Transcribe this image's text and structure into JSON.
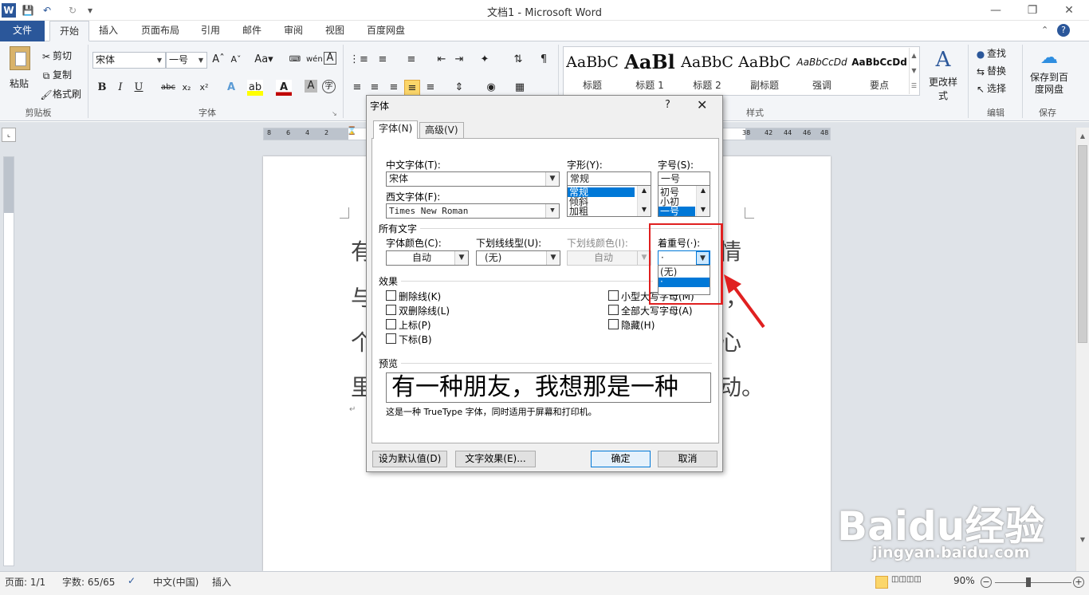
{
  "window": {
    "title": "文档1 - Microsoft Word"
  },
  "ribbon_tabs": [
    "文件",
    "开始",
    "插入",
    "页面布局",
    "引用",
    "邮件",
    "审阅",
    "视图",
    "百度网盘"
  ],
  "clipboard": {
    "paste": "粘贴",
    "cut": "剪切",
    "copy": "复制",
    "format_painter": "格式刷",
    "group": "剪贴板"
  },
  "font_group": {
    "font": "宋体",
    "size": "一号",
    "group": "字体",
    "bold": "B",
    "italic": "I",
    "underline": "U",
    "strike": "abc",
    "sub": "x₂",
    "sup": "x²"
  },
  "paragraph_group": {
    "group": "段落"
  },
  "styles": {
    "items": [
      {
        "preview": "AaBbC",
        "name": "标题"
      },
      {
        "preview": "AaBl",
        "name": "标题 1"
      },
      {
        "preview": "AaBbC",
        "name": "标题 2"
      },
      {
        "preview": "AaBbC",
        "name": "副标题"
      },
      {
        "preview": "AaBbCcDd",
        "name": "强调"
      },
      {
        "preview": "AaBbCcDd",
        "name": "要点"
      }
    ],
    "change_styles": "更改样式",
    "group": "样式"
  },
  "editing": {
    "find": "查找",
    "replace": "替换",
    "select": "选择",
    "group": "编辑"
  },
  "save_group": {
    "save_baidu": "保存到百度网盘",
    "group": "保存"
  },
  "ruler_ticks": [
    "8",
    "6",
    "4",
    "2",
    "2",
    "4",
    "6",
    "8",
    "38",
    "42",
    "44",
    "46",
    "48"
  ],
  "document": {
    "left_chars": [
      "有",
      "与",
      "个",
      "里"
    ],
    "right_chars": [
      "情",
      "，",
      "心",
      "动。"
    ],
    "para_mark": "↵"
  },
  "dialog": {
    "title": "字体",
    "help": "?",
    "tabs": [
      "字体(N)",
      "高级(V)"
    ],
    "cn_font_label": "中文字体(T):",
    "cn_font_value": "宋体",
    "west_font_label": "西文字体(F):",
    "west_font_value": "Times New Roman",
    "style_label": "字形(Y):",
    "style_value": "常规",
    "style_options": [
      "常规",
      "倾斜",
      "加粗"
    ],
    "size_label": "字号(S):",
    "size_value": "一号",
    "size_options": [
      "初号",
      "小初",
      "一号"
    ],
    "all_text_section": "所有文字",
    "font_color_label": "字体颜色(C):",
    "font_color_value": "自动",
    "underline_type_label": "下划线线型(U):",
    "underline_type_value": "(无)",
    "underline_color_label": "下划线颜色(I):",
    "underline_color_value": "自动",
    "emphasis_label": "着重号(·):",
    "emphasis_value": "·",
    "emphasis_options": [
      "(无)",
      "·"
    ],
    "effects_section": "效果",
    "effects_left": [
      "删除线(K)",
      "双删除线(L)",
      "上标(P)",
      "下标(B)"
    ],
    "effects_right": [
      "小型大写字母(M)",
      "全部大写字母(A)",
      "隐藏(H)"
    ],
    "preview_section": "预览",
    "preview_text": "有一种朋友，我想那是一种",
    "preview_note": "这是一种 TrueType 字体，同时适用于屏幕和打印机。",
    "set_default": "设为默认值(D)",
    "text_effects": "文字效果(E)...",
    "ok": "确定",
    "cancel": "取消"
  },
  "statusbar": {
    "page": "页面: 1/1",
    "words": "字数: 65/65",
    "lang": "中文(中国)",
    "mode": "插入",
    "zoom": "90%"
  },
  "watermark": {
    "brand": "Baidu经验",
    "url": "jingyan.baidu.com"
  },
  "colors": {
    "accent": "#2b579a",
    "highlight_box": "#e02020",
    "selection": "#0078d7"
  }
}
